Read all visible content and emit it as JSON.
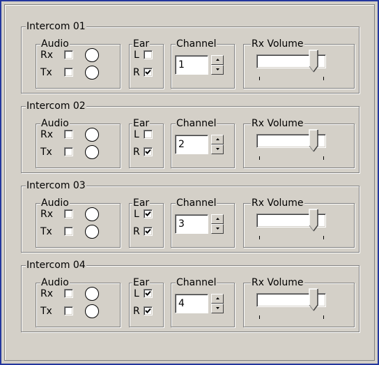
{
  "labels": {
    "audio": "Audio",
    "ear": "Ear",
    "channel": "Channel",
    "rx_volume": "Rx Volume",
    "rx": "Rx",
    "tx": "Tx",
    "left": "L",
    "right": "R"
  },
  "intercoms": [
    {
      "title": "Intercom 01",
      "rx_checked": false,
      "tx_checked": false,
      "ear_left": false,
      "ear_right": true,
      "channel": "1",
      "rx_volume_fraction": 0.85
    },
    {
      "title": "Intercom 02",
      "rx_checked": false,
      "tx_checked": false,
      "ear_left": false,
      "ear_right": true,
      "channel": "2",
      "rx_volume_fraction": 0.85
    },
    {
      "title": "Intercom 03",
      "rx_checked": false,
      "tx_checked": false,
      "ear_left": true,
      "ear_right": true,
      "channel": "3",
      "rx_volume_fraction": 0.85
    },
    {
      "title": "Intercom 04",
      "rx_checked": false,
      "tx_checked": false,
      "ear_left": true,
      "ear_right": true,
      "channel": "4",
      "rx_volume_fraction": 0.85
    }
  ]
}
